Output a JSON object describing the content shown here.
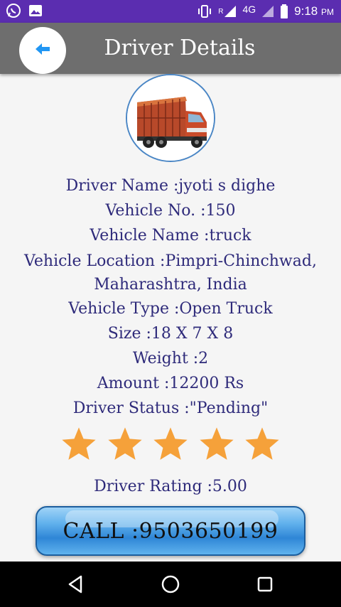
{
  "status_bar": {
    "left_icons": [
      "whatsapp-icon",
      "image-icon"
    ],
    "network": "4G",
    "roaming": "R",
    "time": "9:18",
    "ampm": "PM"
  },
  "header": {
    "title": "Driver Details",
    "back_icon": "arrow-left-icon",
    "accent_color": "#2196f3"
  },
  "details": {
    "driver_name": "Driver Name :jyoti s dighe",
    "vehicle_no": "Vehicle No. :150",
    "vehicle_name": "Vehicle Name :truck",
    "vehicle_location": "Vehicle Location :Pimpri-Chinchwad, Maharashtra, India",
    "vehicle_type": "Vehicle Type :Open Truck",
    "size": "Size :18 X 7 X 8",
    "weight": "Weight :2",
    "amount": "Amount :12200 Rs",
    "driver_status": "Driver Status :\"Pending\""
  },
  "rating": {
    "stars_filled": 5,
    "stars_total": 5,
    "star_color": "#f5a13a",
    "label": "Driver Rating :5.00"
  },
  "call_button": {
    "label": "CALL :9503650199"
  },
  "nav_bar": {
    "items": [
      "back-triangle-icon",
      "home-circle-icon",
      "recents-square-icon"
    ]
  }
}
